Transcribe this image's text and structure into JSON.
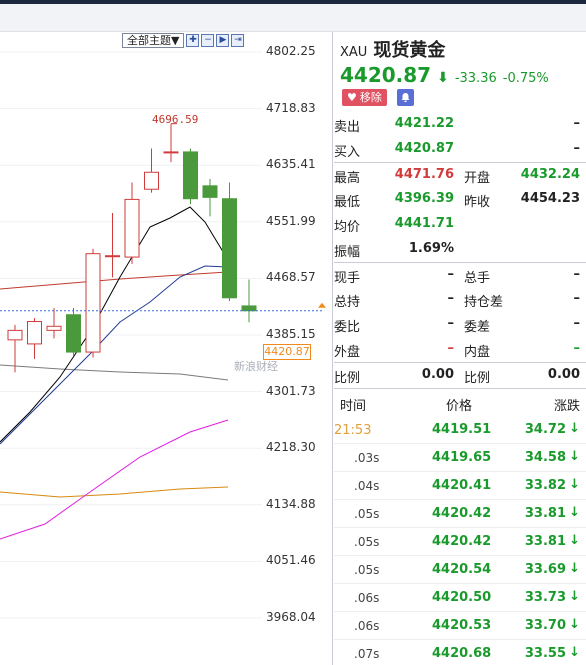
{
  "chart": {
    "theme_label": "全部主题▼",
    "toolbar_icons": [
      "expand-icon",
      "zoom-out-icon",
      "step-forward-icon",
      "end-icon"
    ],
    "y_axis_labels": [
      "4802.25",
      "4718.83",
      "4635.41",
      "4551.99",
      "4468.57",
      "4385.15",
      "4301.73",
      "4218.30",
      "4134.88",
      "4051.46",
      "3968.04"
    ],
    "peak_label": "4696.59",
    "current_price_tag": "4420.87",
    "watermark": "新浪财经",
    "colors": {
      "up": "#d23b3b",
      "down": "#4a9a3c",
      "ma5": "#000000",
      "ma10": "#1f3a93",
      "ma20": "#c0392b",
      "ma60": "#e020e0",
      "ma120": "#d68910",
      "ma30": "#7a7a7a"
    }
  },
  "chart_data": {
    "type": "candlestick",
    "ylim": [
      3968.04,
      4802.25
    ],
    "candles": [
      {
        "open": 4378,
        "close": 4392,
        "high": 4400,
        "low": 4330
      },
      {
        "open": 4372,
        "close": 4405,
        "high": 4410,
        "low": 4350
      },
      {
        "open": 4392,
        "close": 4398,
        "high": 4425,
        "low": 4380
      },
      {
        "open": 4415,
        "close": 4360,
        "high": 4425,
        "low": 4355
      },
      {
        "open": 4360,
        "close": 4505,
        "high": 4512,
        "low": 4352
      },
      {
        "open": 4502,
        "close": 4502,
        "high": 4565,
        "low": 4470
      },
      {
        "open": 4500,
        "close": 4585,
        "high": 4610,
        "low": 4490
      },
      {
        "open": 4600,
        "close": 4625,
        "high": 4660,
        "low": 4595
      },
      {
        "open": 4655,
        "close": 4655,
        "high": 4696.59,
        "low": 4640
      },
      {
        "open": 4655,
        "close": 4586,
        "high": 4660,
        "low": 4578
      },
      {
        "open": 4605,
        "close": 4588,
        "high": 4615,
        "low": 4560
      },
      {
        "open": 4586,
        "close": 4440,
        "high": 4610,
        "low": 4435
      },
      {
        "open": 4428,
        "close": 4420.87,
        "high": 4467,
        "low": 4404
      }
    ]
  },
  "quote": {
    "symbol": "XAU",
    "name": "现货黄金",
    "last": "4420.87",
    "change": "-33.36",
    "change_pct": "-0.75%",
    "remove_label": "移除"
  },
  "rows": [
    {
      "l1": "卖出",
      "v1": "4421.22",
      "c1": "green",
      "l2": "",
      "v2": "–",
      "c2": "dark"
    },
    {
      "l1": "买入",
      "v1": "4420.87",
      "c1": "green",
      "l2": "",
      "v2": "–",
      "c2": "dark"
    },
    {
      "l1": "最高",
      "v1": "4471.76",
      "c1": "red",
      "l2": "开盘",
      "v2": "4432.24",
      "c2": "green"
    },
    {
      "l1": "最低",
      "v1": "4396.39",
      "c1": "green",
      "l2": "昨收",
      "v2": "4454.23",
      "c2": "dark"
    },
    {
      "l1": "均价",
      "v1": "4441.71",
      "c1": "green",
      "l2": "",
      "v2": "",
      "c2": "dark"
    },
    {
      "l1": "振幅",
      "v1": "1.69%",
      "c1": "dark",
      "l2": "",
      "v2": "",
      "c2": "dark"
    },
    {
      "l1": "现手",
      "v1": "–",
      "c1": "dark",
      "l2": "总手",
      "v2": "–",
      "c2": "dark"
    },
    {
      "l1": "总持",
      "v1": "–",
      "c1": "dark",
      "l2": "持仓差",
      "v2": "–",
      "c2": "dark"
    },
    {
      "l1": "委比",
      "v1": "–",
      "c1": "dark",
      "l2": "委差",
      "v2": "–",
      "c2": "dark"
    },
    {
      "l1": "外盘",
      "v1": "–",
      "c1": "red",
      "l2": "内盘",
      "v2": "–",
      "c2": "green"
    },
    {
      "l1": "比例",
      "v1": "0.00",
      "c1": "dark",
      "l2": "比例",
      "v2": "0.00",
      "c2": "dark"
    }
  ],
  "ticks_header": {
    "time": "时间",
    "price": "价格",
    "change": "涨跌"
  },
  "ticks": [
    {
      "time": "21:53",
      "price": "4419.51",
      "change": "34.72"
    },
    {
      "time": ".03s",
      "price": "4419.65",
      "change": "34.58"
    },
    {
      "time": ".04s",
      "price": "4420.41",
      "change": "33.82"
    },
    {
      "time": ".05s",
      "price": "4420.42",
      "change": "33.81"
    },
    {
      "time": ".05s",
      "price": "4420.42",
      "change": "33.81"
    },
    {
      "time": ".05s",
      "price": "4420.54",
      "change": "33.69"
    },
    {
      "time": ".06s",
      "price": "4420.50",
      "change": "33.73"
    },
    {
      "time": ".06s",
      "price": "4420.53",
      "change": "33.70"
    },
    {
      "time": ".07s",
      "price": "4420.68",
      "change": "33.55"
    }
  ]
}
